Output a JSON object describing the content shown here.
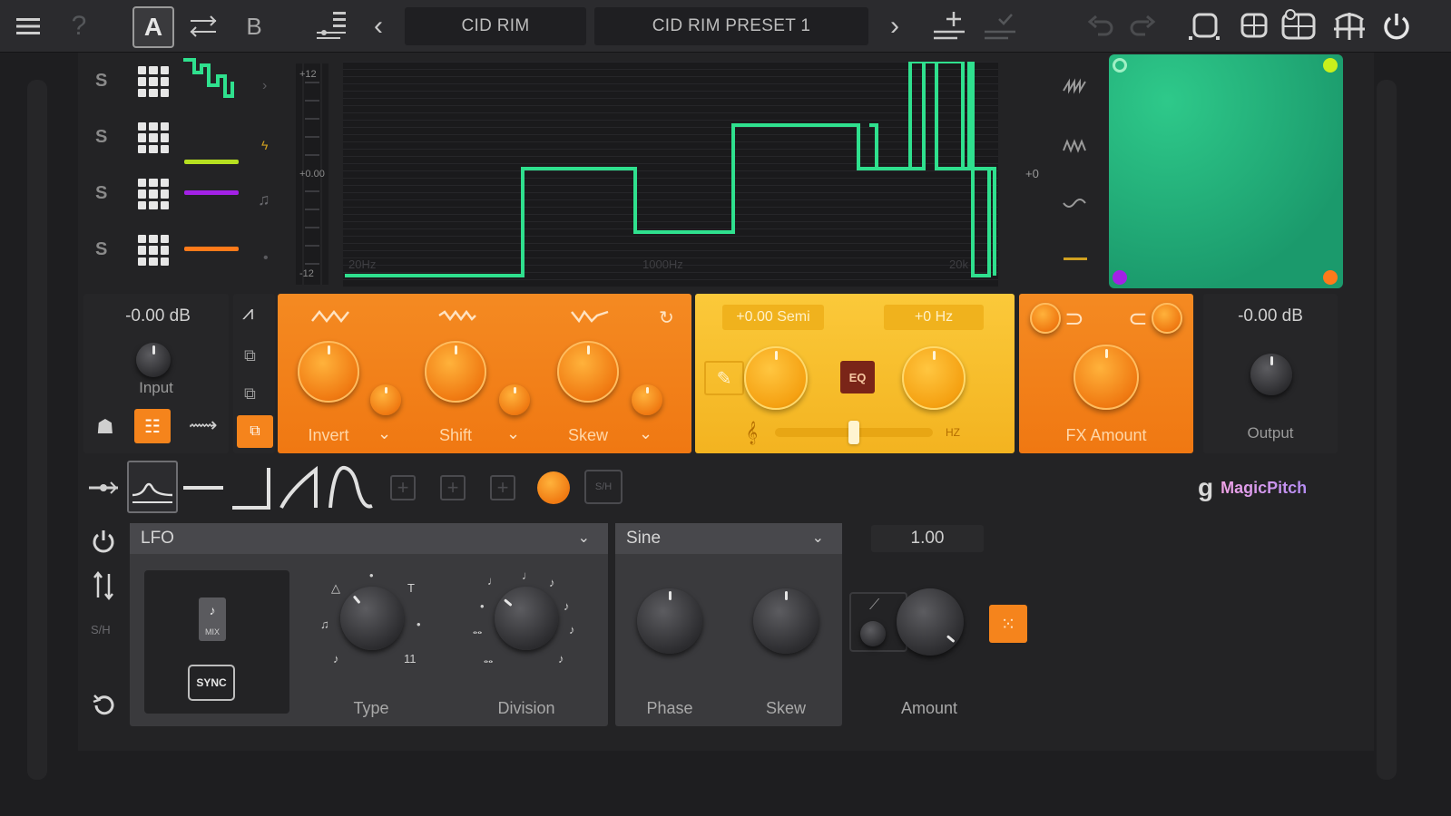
{
  "topbar": {
    "menu_icon": "hamburger-icon",
    "help_label": "?",
    "preset_a_label": "A",
    "preset_b_label": "B",
    "category_name": "CID RIM",
    "preset_name": "CID RIM PRESET 1",
    "prev_label": "‹",
    "next_label": "›"
  },
  "modulators": {
    "solo_labels": [
      "S",
      "S",
      "S",
      "S"
    ],
    "line_colors": [
      "#2fe08e",
      "#b6e020",
      "#a321e6",
      "#ff7a1a"
    ]
  },
  "graph": {
    "freq_low_label": "20Hz",
    "freq_mid_label": "1000Hz",
    "freq_high_label": "20k",
    "meter_top_label": "+12",
    "meter_mid_label": "+0.00",
    "meter_bottom_label": "-12",
    "side_value": "+0",
    "line_color": "#2fe08e"
  },
  "input": {
    "value": "-0.00 dB",
    "label": "Input"
  },
  "shifter": {
    "invert_label": "Invert",
    "shift_label": "Shift",
    "skew_label": "Skew",
    "accent": "#f5841c"
  },
  "tuning": {
    "semitone_value": "+0.00 Semi",
    "hz_value": "+0 Hz",
    "eq_label": "EQ",
    "hz_unit": "HZ",
    "slider_position": 0.5,
    "accent": "#f8c531"
  },
  "fx": {
    "label": "FX Amount"
  },
  "output": {
    "value": "-0.00 dB",
    "label": "Output"
  },
  "shapes": {
    "sh_label": "S/H"
  },
  "brand": {
    "name": "MagicPitch"
  },
  "lfo": {
    "type_dropdown": "LFO",
    "shape_dropdown": "Sine",
    "sync_label": "SYNC",
    "mix_label": "MIX",
    "sh_label": "S/H",
    "type_label": "Type",
    "division_label": "Division",
    "phase_label": "Phase",
    "skew_label": "Skew",
    "amount_value": "1.00",
    "amount_label": "Amount"
  }
}
